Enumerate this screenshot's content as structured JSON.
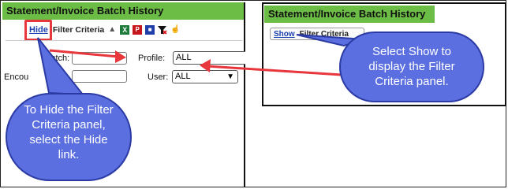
{
  "left": {
    "title": "Statement/Invoice Batch History",
    "hide_link": "Hide",
    "filter_criteria_label": "Filter Criteria",
    "batch_label": "Batch:",
    "profile_label": "Profile:",
    "profile_value": "ALL",
    "encounter_label": "Encou",
    "user_label": "User:",
    "user_value": "ALL",
    "callout": "To Hide the Filter Criteria panel, select the Hide link."
  },
  "right": {
    "title": "Statement/Invoice Batch History",
    "show_link": "Show",
    "filter_criteria_label": "Filter Criteria",
    "callout": "Select Show to display the Filter Criteria panel."
  },
  "colors": {
    "titlebar": "#6cbd45",
    "callout": "#5b6fe0",
    "highlight": "#e8363d",
    "link": "#1a3fb0"
  },
  "icons": [
    "sort-up-icon",
    "excel-icon",
    "pdf-icon",
    "save-icon",
    "clear-filter-icon",
    "hand-icon"
  ]
}
